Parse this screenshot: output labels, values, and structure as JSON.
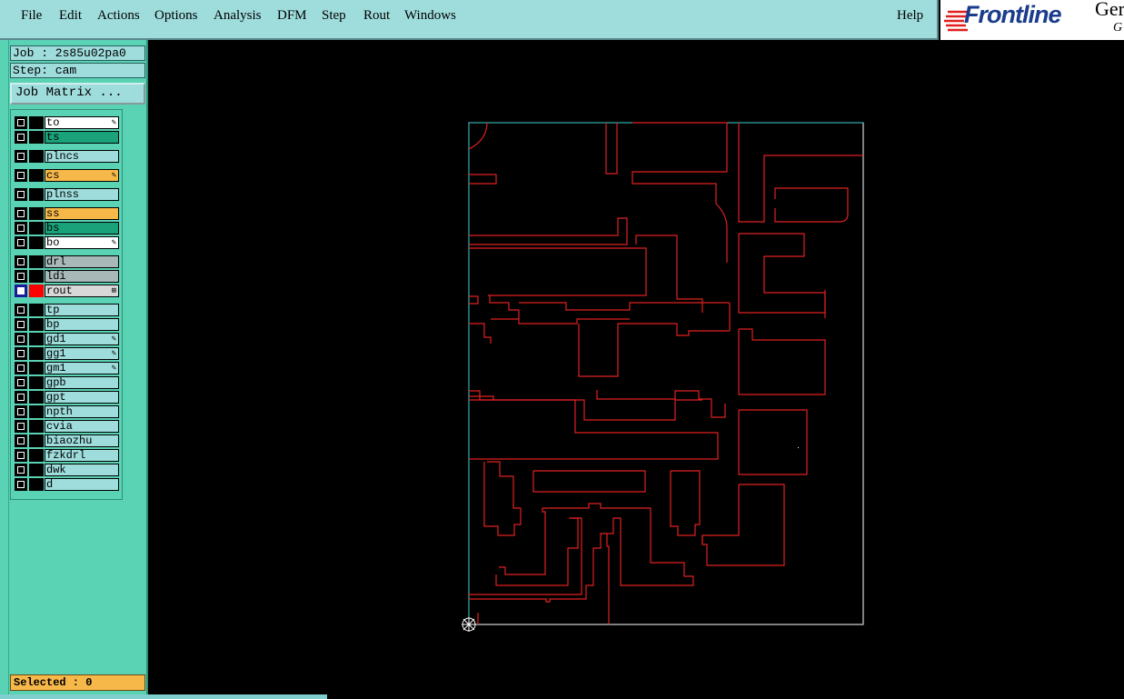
{
  "menu": {
    "items": [
      "File",
      "Edit",
      "Actions",
      "Options",
      "Analysis",
      "DFM",
      "Step",
      "Rout",
      "Windows"
    ],
    "help": "Help"
  },
  "brand": {
    "logo": "Frontline",
    "suffix": "Ger",
    "sub": "G"
  },
  "info": {
    "job": "Job : 2s85u02pa0",
    "step": "Step: cam",
    "job_matrix": "Job Matrix ...",
    "selected": "Selected : 0"
  },
  "layers": [
    {
      "name": "to",
      "bg": "#ffffff",
      "mark": "✎"
    },
    {
      "name": "ts",
      "bg": "#1aa37a",
      "mark": ""
    },
    {
      "name": "plncs",
      "bg": "#9fdcdc",
      "mark": ""
    },
    {
      "name": "cs",
      "bg": "#f7b84a",
      "mark": "✎"
    },
    {
      "name": "plnss",
      "bg": "#9fdcdc",
      "mark": ""
    },
    {
      "name": "ss",
      "bg": "#f7b84a",
      "mark": ""
    },
    {
      "name": "bs",
      "bg": "#1aa37a",
      "mark": ""
    },
    {
      "name": "bo",
      "bg": "#ffffff",
      "mark": "✎"
    },
    {
      "name": "drl",
      "bg": "#a8b8b8",
      "mark": ""
    },
    {
      "name": "ldi",
      "bg": "#a8b8b8",
      "mark": ""
    },
    {
      "name": "rout",
      "bg": "#d8d8d8",
      "mark": "⊞"
    },
    {
      "name": "tp",
      "bg": "#9fdcdc",
      "mark": ""
    },
    {
      "name": "bp",
      "bg": "#9fdcdc",
      "mark": ""
    },
    {
      "name": "gd1",
      "bg": "#9fdcdc",
      "mark": "✎"
    },
    {
      "name": "gg1",
      "bg": "#9fdcdc",
      "mark": "✎"
    },
    {
      "name": "gm1",
      "bg": "#9fdcdc",
      "mark": "✎"
    },
    {
      "name": "gpb",
      "bg": "#9fdcdc",
      "mark": ""
    },
    {
      "name": "gpt",
      "bg": "#9fdcdc",
      "mark": ""
    },
    {
      "name": "npth",
      "bg": "#9fdcdc",
      "mark": ""
    },
    {
      "name": "cvia",
      "bg": "#9fdcdc",
      "mark": ""
    },
    {
      "name": "biaozhu",
      "bg": "#9fdcdc",
      "mark": ""
    },
    {
      "name": "fzkdrl",
      "bg": "#9fdcdc",
      "mark": ""
    },
    {
      "name": "dwk",
      "bg": "#9fdcdc",
      "mark": ""
    },
    {
      "name": "d",
      "bg": "#9fdcdc",
      "mark": ""
    }
  ],
  "colors": {
    "rout_line": "#e02020",
    "profile": "#ffffff",
    "profile_edge": "#40d0d0",
    "active_layer_color": "#ff0000",
    "active_layer_check": "#1a1a9a"
  }
}
